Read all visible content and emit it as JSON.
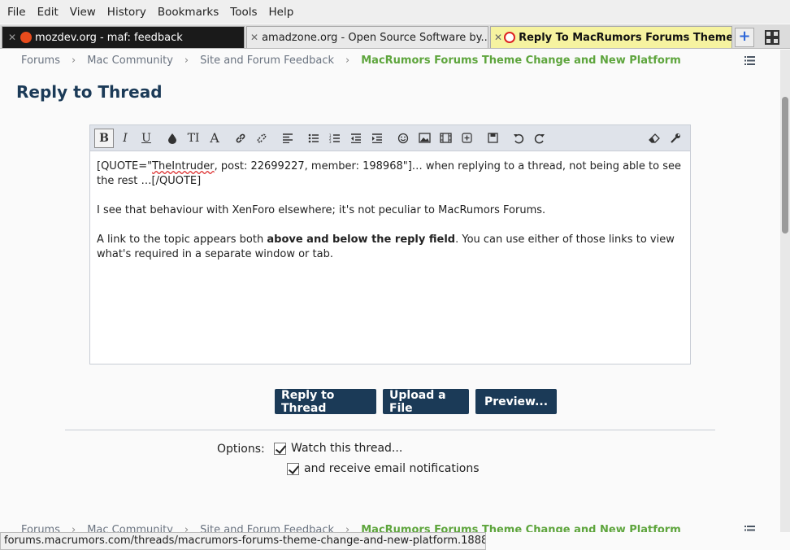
{
  "menu": [
    "File",
    "Edit",
    "View",
    "History",
    "Bookmarks",
    "Tools",
    "Help"
  ],
  "tabs": [
    {
      "label": "mozdev.org - maf: feedback"
    },
    {
      "label": "amadzone.org - Open Source Software by..."
    },
    {
      "label": "Reply To MacRumors Forums Theme ..."
    }
  ],
  "new_tab_glyph": "+",
  "breadcrumb": {
    "items": [
      "Forums",
      "Mac Community",
      "Site and Forum Feedback",
      "MacRumors Forums Theme Change and New Platform"
    ],
    "separator": "›"
  },
  "page_title": "Reply to Thread",
  "editor": {
    "toolbar": {
      "bold": "B",
      "italic": "I",
      "underline": "U",
      "tools": [
        "color-icon",
        "font-size-icon",
        "font-family-icon",
        "link-icon",
        "unlink-icon",
        "align-icon",
        "unordered-list-icon",
        "ordered-list-icon",
        "outdent-icon",
        "indent-icon",
        "smilie-icon",
        "image-icon",
        "media-icon",
        "insert-icon",
        "save-draft-icon",
        "undo-icon",
        "redo-icon",
        "remove-formatting-icon",
        "settings-icon"
      ]
    },
    "content": {
      "quote_prefix": "[QUOTE=\"",
      "quote_user": "TheIntruder",
      "quote_suffix": ", post: 22699227, member: 198968\"]… when replying to a thread, not being able to see the rest …[/QUOTE]",
      "para2": "I see that behaviour with XenForo elsewhere; it's not peculiar to MacRumors Forums.",
      "para3_start": "A link to the topic appears both ",
      "para3_bold": "above and below the reply field",
      "para3_end": ". You can use either of those links to view what's required in a separate window or tab."
    }
  },
  "buttons": {
    "reply": "Reply to Thread",
    "upload": "Upload a File",
    "preview": "Preview..."
  },
  "options": {
    "label": "Options:",
    "watch": {
      "label": "Watch this thread...",
      "checked": true
    },
    "email": {
      "label": "and receive email notifications",
      "checked": true
    }
  },
  "status_url": "forums.macrumors.com/threads/macrumors-forums-theme-change-and-new-platform.1888113/",
  "colors": {
    "accent": "#1b3a57",
    "breadcrumb_current": "#5ea53d",
    "active_tab": "#f6f3a0"
  }
}
